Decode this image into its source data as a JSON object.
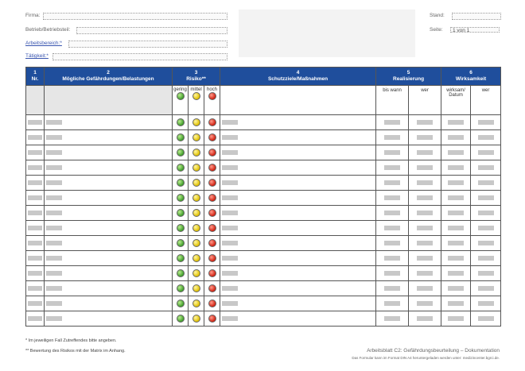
{
  "header": {
    "firma_label": "Firma:",
    "betrieb_label": "Betrieb/Betriebsteil:",
    "arbeitsbereich_label": "Arbeitsbereich:*",
    "taetigkeit_label": "Tätigkeit:*",
    "stand_label": "Stand:",
    "seite_label": "Seite:",
    "seite_value": "1 von 1"
  },
  "table": {
    "columns": [
      {
        "num": "1",
        "title": "Nr."
      },
      {
        "num": "2",
        "title": "Mögliche Gefährdungen/Belastungen"
      },
      {
        "num": "3",
        "title": "Risiko**"
      },
      {
        "num": "4",
        "title": "Schutzziele/Maßnahmen"
      },
      {
        "num": "5",
        "title": "Realisierung"
      },
      {
        "num": "6",
        "title": "Wirksamkeit"
      }
    ],
    "risk_levels": [
      "gering",
      "mittel",
      "hoch"
    ],
    "realisierung_sub": [
      "bis wann",
      "wer"
    ],
    "wirksamkeit_sub": [
      "wirksam/ Datum",
      "wer"
    ],
    "row_count": 14
  },
  "footer": {
    "note1": "*   Im jeweiligen Fall Zutreffendes bitte angeben.",
    "note2": "**  Bewertung des Risikos mit der Matrix im Anhang.",
    "doc_title": "Arbeitsblatt C2: Gefährdungsbeurteilung – Dokumentation",
    "doc_note": "Das Formular kann im Format DIN A4 heruntergeladen werden unter: medizincenter.bgrci.de."
  }
}
